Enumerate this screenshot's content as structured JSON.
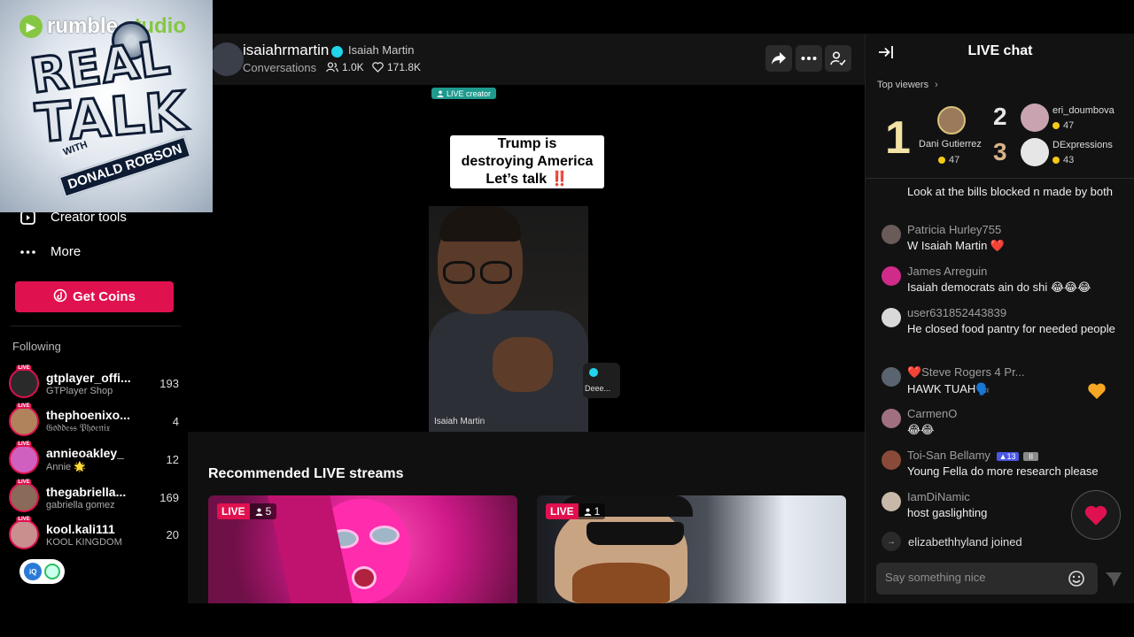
{
  "colors": {
    "live_red": "#e0114f",
    "verified_cyan": "#20d5ec",
    "coin_gold": "#f6c915",
    "rumble_green": "#85c742"
  },
  "logo": {
    "brand": "rumble",
    "brand_suffix": "studio",
    "line1": "REAL",
    "line2": "TALK",
    "line3": "WITH",
    "line4": "DONALD ROBSON"
  },
  "sidebar": {
    "nav": [
      {
        "label": "Creator tools",
        "icon": "creator-tools-icon"
      },
      {
        "label": "More",
        "icon": "more-dots-icon"
      }
    ],
    "get_coins_label": "Get Coins",
    "following_title": "Following",
    "following": [
      {
        "name": "gtplayer_offi...",
        "sub": "GTPlayer Shop",
        "count": "193",
        "avatar_color": "#2a2a2a"
      },
      {
        "name": "thephoenixo...",
        "sub": "𝔊𝔬𝔡𝔡𝔢𝔰𝔰 𝔓𝔥𝔬𝔢𝔫𝔦𝔵",
        "count": "4",
        "avatar_color": "#b0835c"
      },
      {
        "name": "annieoakley_",
        "sub": "Annie 🌟",
        "count": "12",
        "avatar_color": "#d060c0"
      },
      {
        "name": "thegabriella...",
        "sub": "gabriella gomez",
        "count": "169",
        "avatar_color": "#8a6a58"
      },
      {
        "name": "kool.kali111",
        "sub": "KOOL KINGDOM",
        "count": "20",
        "avatar_color": "#c98f8f"
      }
    ],
    "live_mini_label": "LIVE"
  },
  "stream": {
    "streamer": "isaiahrmartin",
    "nickname": "Isaiah Martin",
    "category": "Conversations",
    "viewers": "1.0K",
    "likes": "171.8K",
    "live_creator_label": "LIVE creator",
    "overlay_lines": [
      "Trump is",
      "destroying America",
      "Let’s talk ‼️"
    ],
    "video_watermark": "Isaiah Martin",
    "guest_label": "Deee..."
  },
  "recommended": {
    "title": "Recommended LIVE streams",
    "live_label": "LIVE",
    "cards": [
      {
        "viewers": "5"
      },
      {
        "viewers": "1"
      }
    ]
  },
  "chat": {
    "title": "LIVE chat",
    "top_viewers_label": "Top viewers",
    "top_viewers": [
      {
        "rank": "1",
        "name": "Dani Gutierrez",
        "coins": "47"
      },
      {
        "rank": "2",
        "name": "eri_doumbova",
        "coins": "47"
      },
      {
        "rank": "3",
        "name": "DExpressions",
        "coins": "43"
      }
    ],
    "messages": [
      {
        "user": "",
        "text": "Look at the bills blocked n made by both",
        "avatar_color": ""
      },
      {
        "user": "Patricia Hurley755",
        "text": "W Isaiah Martin ❤️",
        "avatar_color": "#6a5a58"
      },
      {
        "user": "James Arreguin",
        "text": "Isaiah democrats ain do shi 😂😂😂",
        "avatar_color": "#d02a8a"
      },
      {
        "user": "user631852443839",
        "text": "He closed food pantry for needed people",
        "avatar_color": "#d9d9d9"
      },
      {
        "user": "❤️Steve Rogers 4 Pr...",
        "text": "HAWK TUAH🗣️",
        "avatar_color": "#5a6470"
      },
      {
        "user": "CarmenO",
        "text": "😂😂",
        "avatar_color": "#a07080"
      },
      {
        "user": "Toi-San Bellamy",
        "text": "Young Fella do more research please",
        "avatar_color": "#8a4a3a",
        "level": "13",
        "grey_badge": "II"
      },
      {
        "user": "IamDiNamic",
        "text": "host gaslighting",
        "avatar_color": "#c8b8a8"
      }
    ],
    "joined_text": "elizabethhyland joined",
    "input_placeholder": "Say something nice"
  }
}
